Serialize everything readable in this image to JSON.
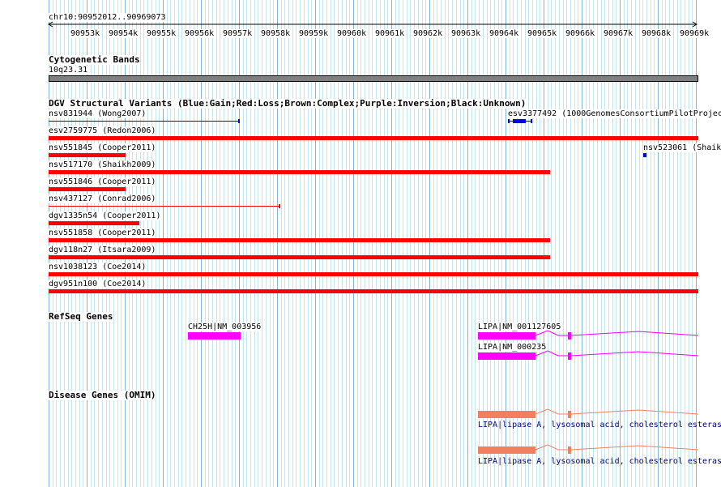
{
  "ruler": {
    "location": "chr10:90952012..90969073",
    "ticks": [
      "90953k",
      "90954k",
      "90955k",
      "90956k",
      "90957k",
      "90958k",
      "90959k",
      "90960k",
      "90961k",
      "90962k",
      "90963k",
      "90964k",
      "90965k",
      "90966k",
      "90967k",
      "90968k",
      "90969k"
    ]
  },
  "cytobands": {
    "title": "Cytogenetic Bands",
    "band": "10q23.31"
  },
  "dgv": {
    "title": "DGV Structural Variants (Blue:Gain;Red:Loss;Brown:Complex;Purple:Inversion;Black:Unknown)",
    "variants": [
      "nsv831944 (Wong2007)",
      "esv3377492 (1000GenomesConsortiumPilotProject",
      "esv2759775 (Redon2006)",
      "nsv551845 (Cooper2011)",
      "nsv523061 (Shaik",
      "nsv517170 (Shaikh2009)",
      "nsv551846 (Cooper2011)",
      "nsv437127 (Conrad2006)",
      "dgv1335n54 (Cooper2011)",
      "nsv551858 (Cooper2011)",
      "dgv118n27 (Itsara2009)",
      "nsv1038123 (Coe2014)",
      "dgv951n100 (Coe2014)"
    ],
    "colors": {
      "gain": "#0000ff",
      "loss": "#ff0000"
    }
  },
  "refseq": {
    "title": "RefSeq Genes",
    "genes": [
      "CH25H|NM_003956",
      "LIPA|NM_001127605",
      "LIPA|NM_000235"
    ],
    "color": "#ff00ff"
  },
  "omim": {
    "title": "Disease Genes (OMIM)",
    "genes": [
      "LIPA|lipase A, lysosomal acid, cholesterol esteras",
      "LIPA|lipase A, lysosomal acid, cholesterol esteras"
    ],
    "color": "#f08060"
  }
}
